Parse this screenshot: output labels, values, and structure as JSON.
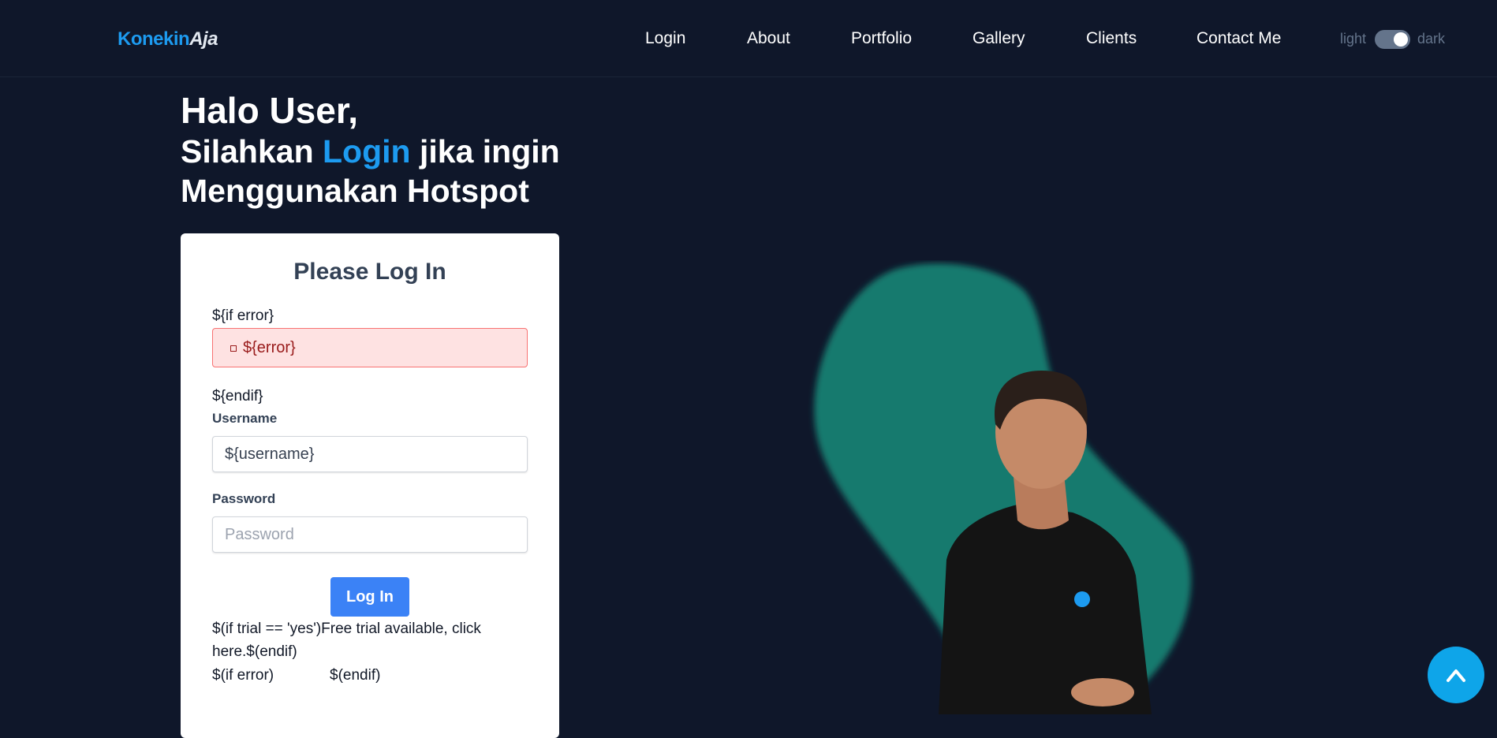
{
  "header": {
    "brand_part1": "Konekin",
    "brand_part2": "Aja",
    "nav": [
      "Login",
      "About",
      "Portfolio",
      "Gallery",
      "Clients",
      "Contact Me"
    ],
    "theme_toggle": {
      "light_label": "light",
      "dark_label": "dark",
      "state": "dark"
    }
  },
  "hero": {
    "line1": "Halo User,",
    "line2_pre": "Silahkan ",
    "line2_accent": "Login",
    "line2_post": " jika ingin",
    "line3": "Menggunakan Hotspot"
  },
  "login_card": {
    "title": "Please Log In",
    "if_error": "${if error}",
    "error_message": "${error}",
    "endif": "${endif}",
    "username_label": "Username",
    "username_value": "${username}",
    "password_label": "Password",
    "password_placeholder": "Password",
    "submit_label": "Log In",
    "trial_line1": "$(if trial == 'yes')Free trial available, click",
    "trial_line2": "here.$(endif)",
    "error_if": "$(if error)",
    "error_endif": "$(endif)"
  },
  "colors": {
    "background": "#0f172a",
    "accent": "#1d9bf0",
    "button": "#3b82f6",
    "error_bg": "#fee2e2",
    "blob": "#147a6e"
  },
  "icons": {
    "scroll_top": "chevron-up-icon",
    "error": "square-icon"
  }
}
